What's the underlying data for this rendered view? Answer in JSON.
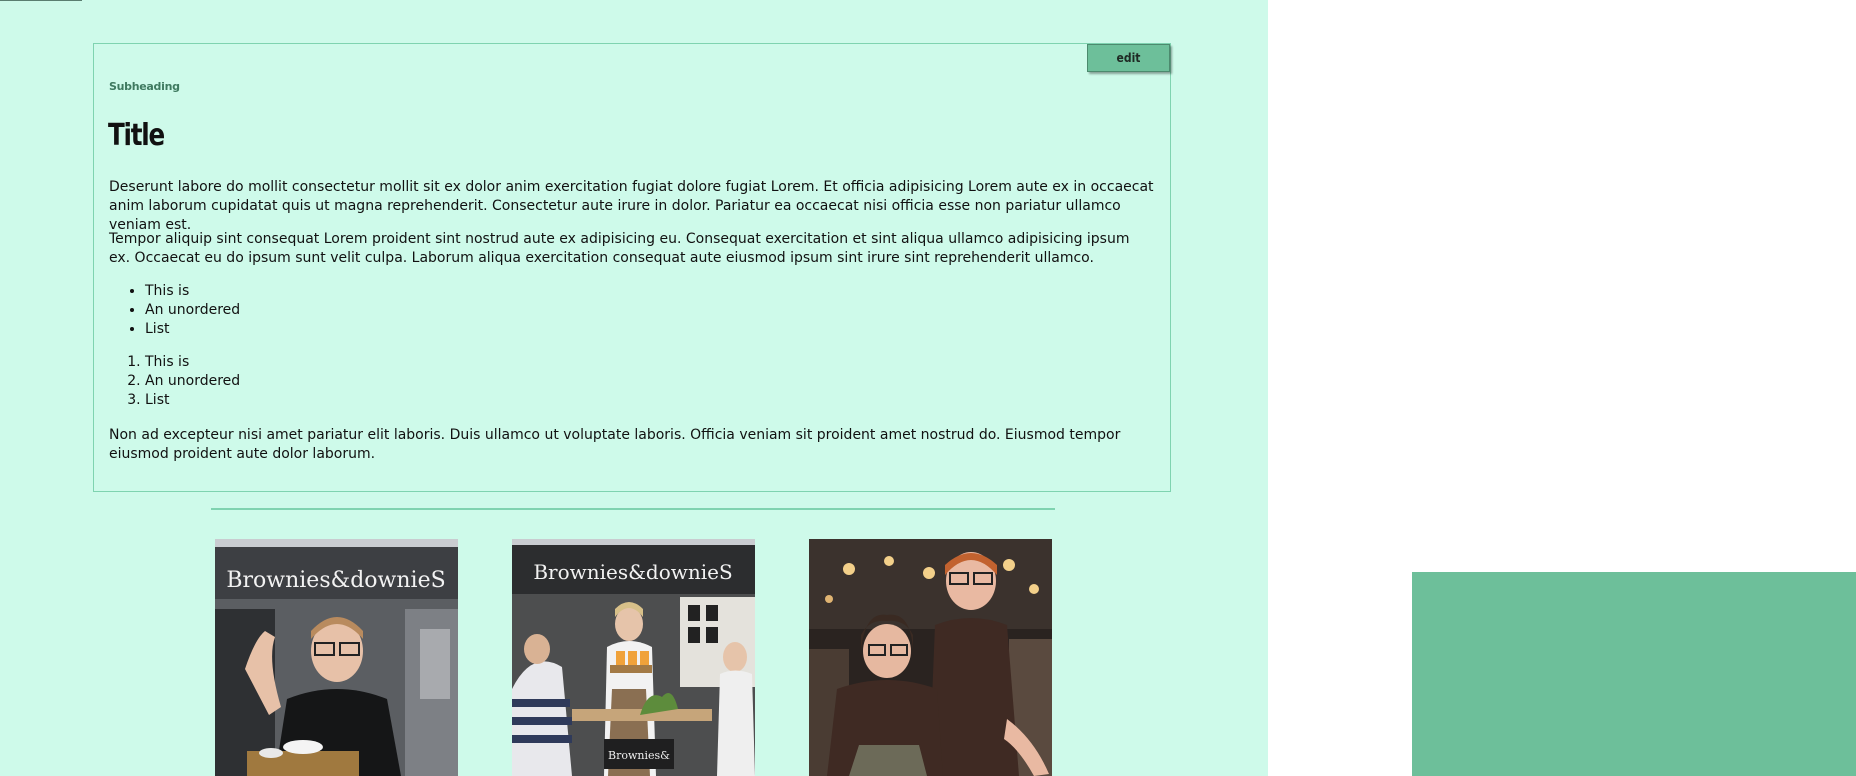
{
  "card": {
    "edit_label": "edit",
    "subheading": "Subheading",
    "title": "Title",
    "paragraphs": [
      "Deserunt labore do mollit consectetur mollit sit ex dolor anim exercitation fugiat dolore fugiat Lorem. Et officia adipisicing Lorem aute ex in occaecat anim laborum cupidatat quis ut magna reprehenderit. Consectetur aute irure in dolor. Pariatur ea occaecat nisi officia esse non pariatur ullamco veniam est.",
      "Tempor aliquip sint consequat Lorem proident sint nostrud aute ex adipisicing eu. Consequat exercitation et sint aliqua ullamco adipisicing ipsum ex. Occaecat eu do ipsum sunt velit culpa. Laborum aliqua exercitation consequat aute eiusmod ipsum sint irure sint reprehenderit ullamco.",
      "Non ad excepteur nisi amet pariatur elit laboris. Duis ullamco ut voluptate laboris. Officia veniam sit proident amet nostrud do. Eiusmod tempor eiusmod proident aute dolor laborum."
    ],
    "unordered_list": [
      "This is",
      "An unordered",
      "List"
    ],
    "ordered_list": [
      "This is",
      "An unordered",
      "List"
    ]
  },
  "gallery": {
    "sign_text": "Brownies&downieS"
  },
  "colors": {
    "background": "#cefaea",
    "accent": "#6dbf9a",
    "border": "#7fd3b0"
  }
}
